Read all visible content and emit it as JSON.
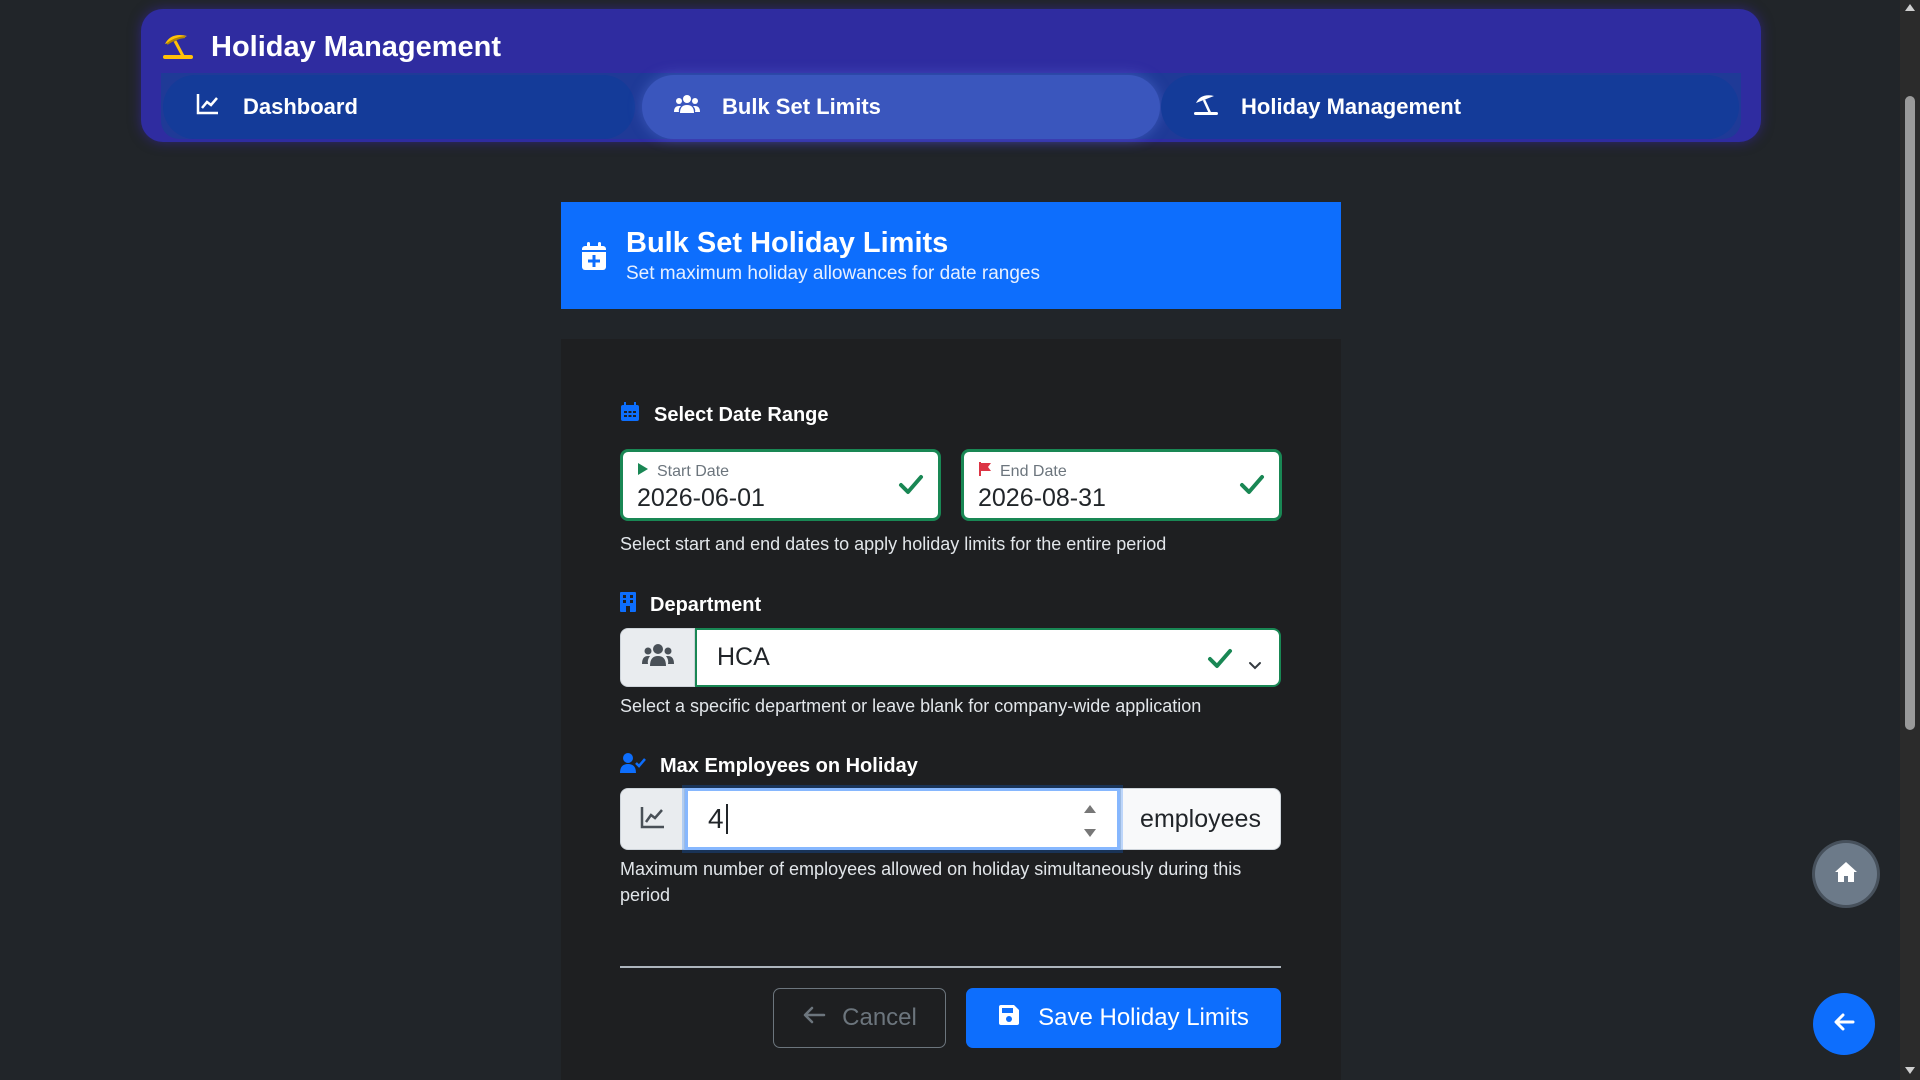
{
  "app": {
    "title": "Holiday Management"
  },
  "nav": {
    "tabs": [
      {
        "label": "Dashboard",
        "icon": "chart-line-icon",
        "active": false
      },
      {
        "label": "Bulk Set Limits",
        "icon": "users-icon",
        "active": true
      },
      {
        "label": "Holiday Management",
        "icon": "umbrella-beach-icon",
        "active": false
      }
    ]
  },
  "card": {
    "title": "Bulk Set Holiday Limits",
    "subtitle": "Set maximum holiday allowances for date ranges"
  },
  "date_range": {
    "label": "Select Date Range",
    "start_label": "Start Date",
    "start_value": "2026-06-01",
    "end_label": "End Date",
    "end_value": "2026-08-31",
    "help": "Select start and end dates to apply holiday limits for the entire period"
  },
  "department": {
    "label": "Department",
    "selected": "HCA",
    "help": "Select a specific department or leave blank for company-wide application"
  },
  "max_employees": {
    "label": "Max Employees on Holiday",
    "value": "4",
    "suffix": "employees",
    "help": "Maximum number of employees allowed on holiday simultaneously during this period"
  },
  "actions": {
    "cancel_label": "Cancel",
    "save_label": "Save Holiday Limits"
  },
  "colors": {
    "primary": "#0d6efd",
    "success": "#198754",
    "nav_bg": "#2f2ca0",
    "brand_icon": "#ffc107",
    "flag": "#dc3545"
  }
}
